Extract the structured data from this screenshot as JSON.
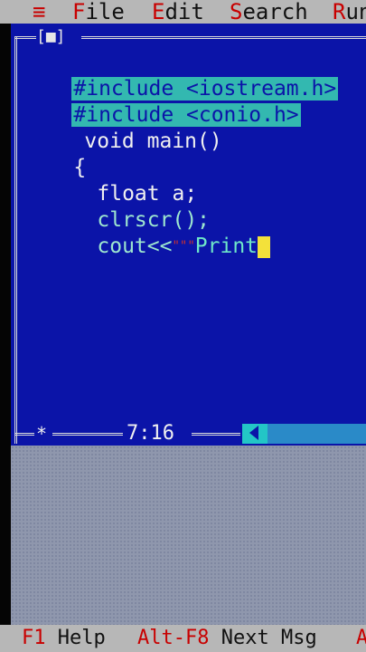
{
  "menu": {
    "items": [
      {
        "label": "≡"
      },
      {
        "hot": "F",
        "rest": "ile"
      },
      {
        "hot": "E",
        "rest": "dit"
      },
      {
        "hot": "S",
        "rest": "earch"
      },
      {
        "hot": "R",
        "rest": "un"
      }
    ]
  },
  "editor": {
    "close_box": "[■]",
    "lines": [
      {
        "text": "#include <iostream.h>"
      },
      {
        "text": "#include <conio.h>"
      },
      {
        "text": "void main()"
      },
      {
        "text": "{"
      },
      {
        "text": "float a;"
      },
      {
        "text": "clrscr();"
      },
      {
        "code": "cout<<",
        "quote": "\"\"\"",
        "string": "Print"
      }
    ],
    "star": "*",
    "cursor_position": "7:16"
  },
  "status": {
    "items": [
      {
        "key": "F1",
        "label": "Help"
      },
      {
        "key": "Alt-F8",
        "label": "Next Msg"
      },
      {
        "key": "A",
        "label": ""
      }
    ]
  },
  "colors": {
    "editor_bg": "#0b14a8",
    "highlight": "#33b8b0",
    "cursor": "#f3e13a",
    "hotkey": "#c80000",
    "menu_bg": "#b7b7b7"
  }
}
